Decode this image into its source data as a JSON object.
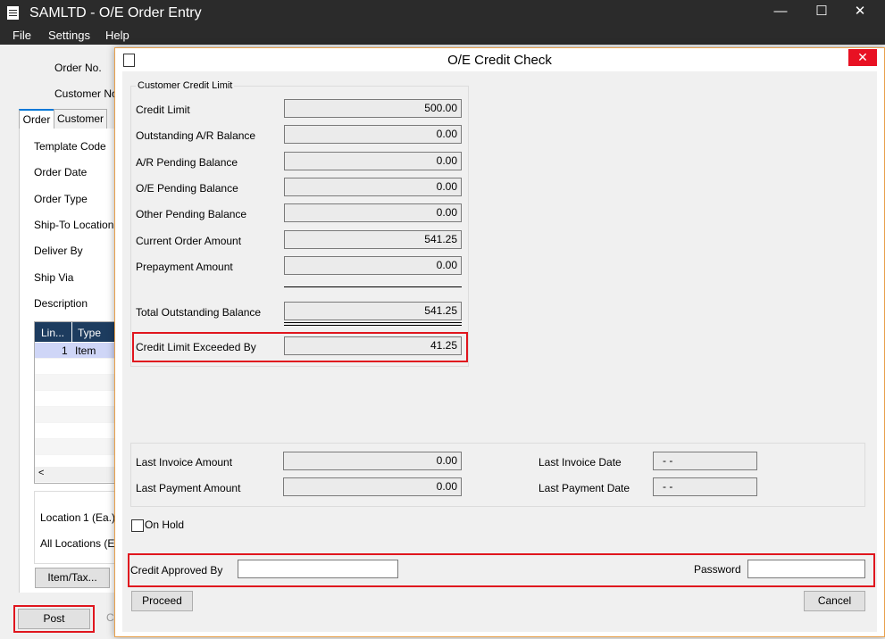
{
  "window": {
    "title": "SAMLTD - O/E Order Entry",
    "minimize": "—",
    "maximize": "☐",
    "close": "✕"
  },
  "menu": [
    "File",
    "Settings",
    "Help"
  ],
  "order": {
    "order_no_label": "Order No.",
    "customer_no_label": "Customer No.",
    "tabs": [
      "Order",
      "Customer"
    ],
    "fields": [
      "Template Code",
      "Order Date",
      "Order Type",
      "Ship-To Location",
      "Deliver By",
      "Ship Via",
      "Description"
    ],
    "grid": {
      "headers": [
        "Lin...",
        "Type"
      ],
      "rows": [
        {
          "line": "1",
          "type": "Item"
        }
      ]
    },
    "location_label": "Location",
    "location_value": "1 (Ea.)",
    "all_locations_label": "All Locations (Ea.",
    "item_tax_button": "Item/Tax...",
    "post_button": "Post",
    "partial_button": "C"
  },
  "dialog": {
    "title": "O/E Credit Check",
    "close": "✕",
    "group_title": "Customer Credit Limit",
    "rows": [
      {
        "label": "Credit Limit",
        "value": "500.00"
      },
      {
        "label": "Outstanding A/R Balance",
        "value": "0.00"
      },
      {
        "label": "A/R Pending Balance",
        "value": "0.00"
      },
      {
        "label": "O/E Pending Balance",
        "value": "0.00"
      },
      {
        "label": "Other Pending Balance",
        "value": "0.00"
      },
      {
        "label": "Current Order Amount",
        "value": "541.25"
      },
      {
        "label": "Prepayment Amount",
        "value": "0.00"
      }
    ],
    "total": {
      "label": "Total Outstanding Balance",
      "value": "541.25"
    },
    "exceeded": {
      "label": "Credit Limit Exceeded By",
      "value": "41.25"
    },
    "last_invoice_amount": {
      "label": "Last Invoice Amount",
      "value": "0.00"
    },
    "last_payment_amount": {
      "label": "Last Payment Amount",
      "value": "0.00"
    },
    "last_invoice_date": {
      "label": "Last Invoice Date",
      "value": "-   -"
    },
    "last_payment_date": {
      "label": "Last Payment Date",
      "value": "-   -"
    },
    "on_hold_label": "On Hold",
    "credit_approved_by_label": "Credit Approved By",
    "credit_approved_by_value": "",
    "password_label": "Password",
    "password_value": "",
    "proceed_button": "Proceed",
    "cancel_button": "Cancel"
  },
  "colors": {
    "highlight": "#e0161e",
    "title_bar": "#2b2b2b",
    "dialog_border": "#e8a04b",
    "grid_header": "#1d3c5f"
  }
}
